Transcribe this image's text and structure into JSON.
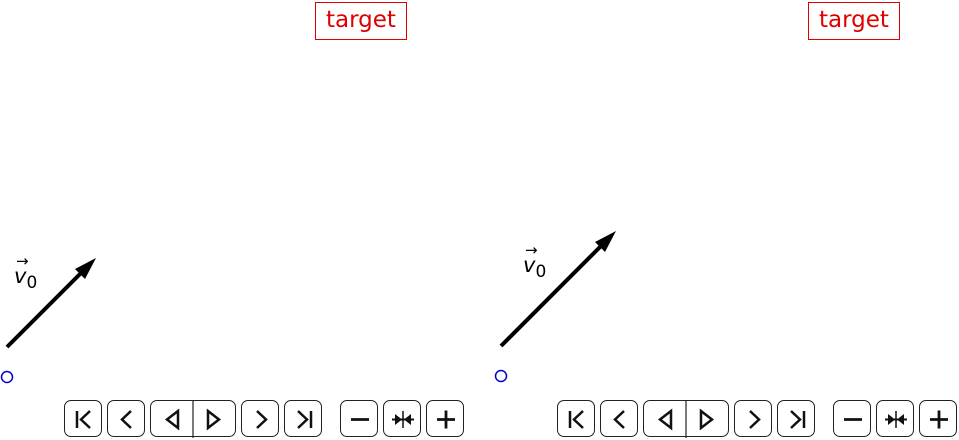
{
  "panels": [
    {
      "id": "left",
      "target_label": "target",
      "vector_label": {
        "symbol": "v",
        "subscript": "0",
        "arrow": "→"
      },
      "player_controls": [
        "skip-to-start",
        "step-back",
        "play-backward",
        "play-forward",
        "step-forward",
        "skip-to-end"
      ],
      "zoom_controls": [
        "zoom-out",
        "zoom-reset",
        "zoom-in"
      ]
    },
    {
      "id": "right",
      "target_label": "target",
      "vector_label": {
        "symbol": "v",
        "subscript": "0",
        "arrow": "→"
      },
      "player_controls": [
        "skip-to-start",
        "step-back",
        "play-backward",
        "play-forward",
        "step-forward",
        "skip-to-end"
      ],
      "zoom_controls": [
        "zoom-out",
        "zoom-reset",
        "zoom-in"
      ]
    }
  ],
  "colors": {
    "target": "#e00000",
    "origin_marker": "#0000cc",
    "vector": "#000000"
  }
}
